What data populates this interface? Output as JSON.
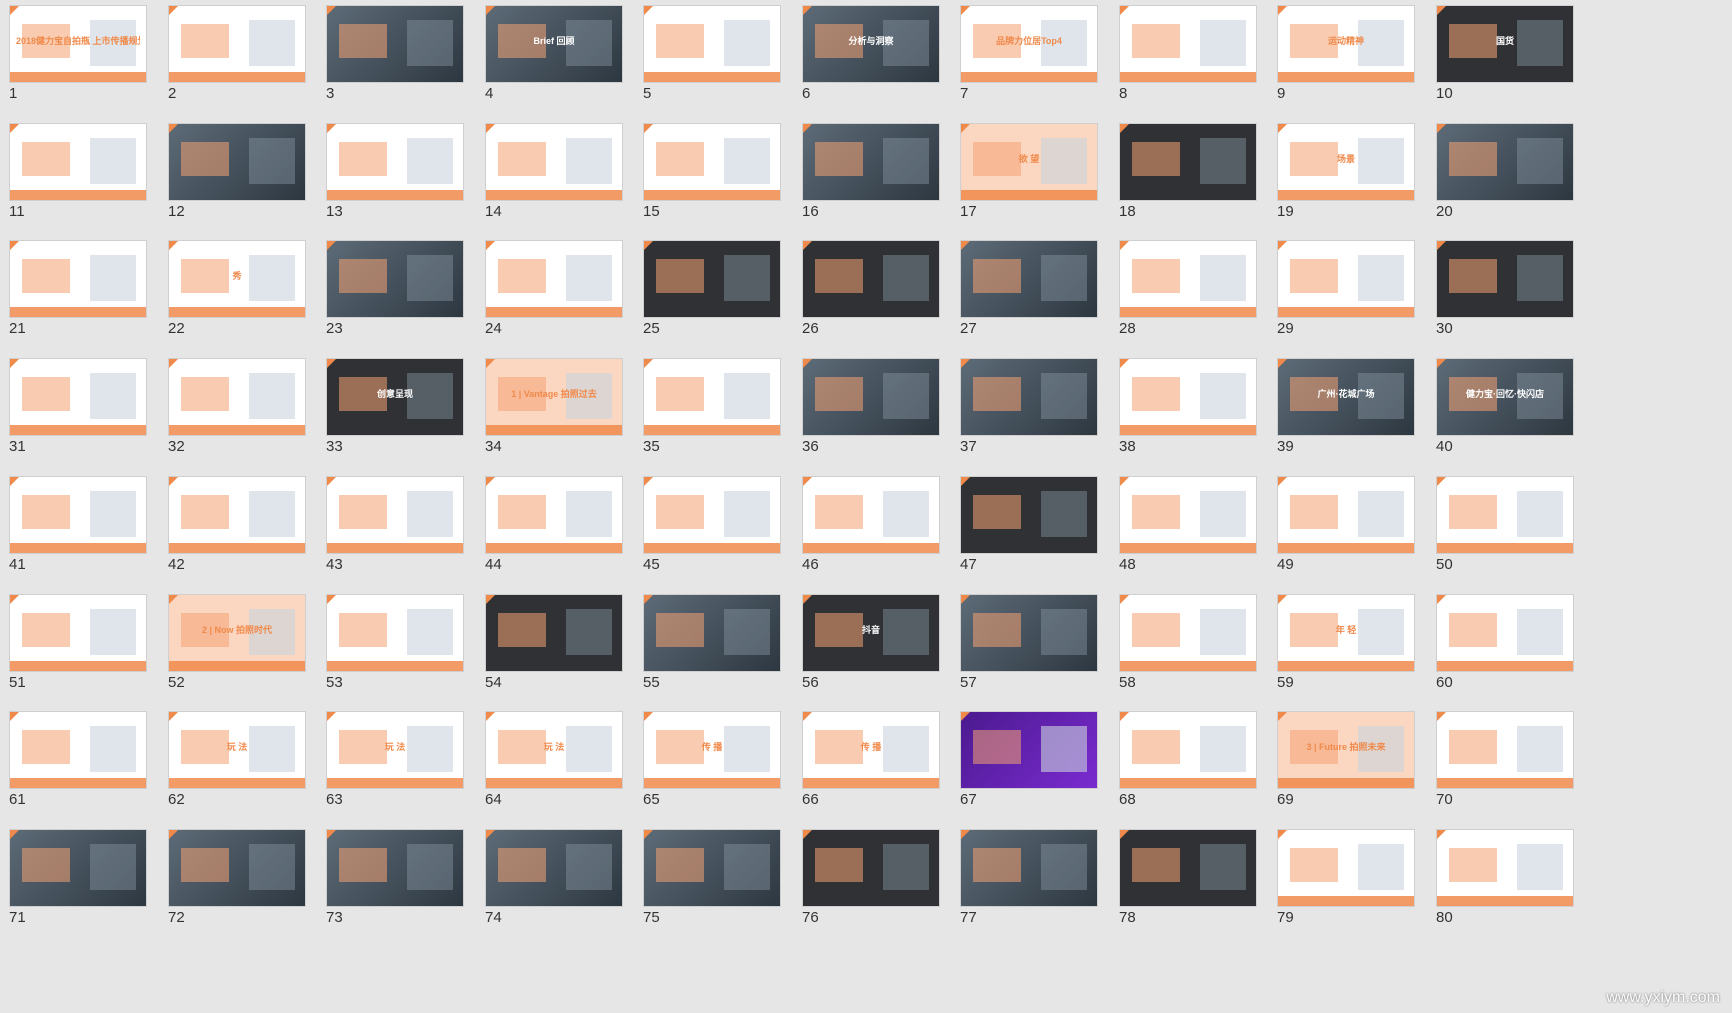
{
  "slides": [
    {
      "number": "1",
      "caption": "2018健力宝自拍瓶 上市传播规划",
      "style": "white"
    },
    {
      "number": "2",
      "caption": "",
      "style": "white"
    },
    {
      "number": "3",
      "caption": "",
      "style": "photo"
    },
    {
      "number": "4",
      "caption": "Brief 回顾",
      "style": "photo"
    },
    {
      "number": "5",
      "caption": "",
      "style": "white"
    },
    {
      "number": "6",
      "caption": "分析与洞察",
      "style": "photo"
    },
    {
      "number": "7",
      "caption": "品牌力位居Top4",
      "style": "white"
    },
    {
      "number": "8",
      "caption": "",
      "style": "white"
    },
    {
      "number": "9",
      "caption": "运动精神",
      "style": "white"
    },
    {
      "number": "10",
      "caption": "国货",
      "style": "dark"
    },
    {
      "number": "11",
      "caption": "",
      "style": "white"
    },
    {
      "number": "12",
      "caption": "",
      "style": "photo"
    },
    {
      "number": "13",
      "caption": "",
      "style": "white"
    },
    {
      "number": "14",
      "caption": "",
      "style": "white"
    },
    {
      "number": "15",
      "caption": "",
      "style": "white"
    },
    {
      "number": "16",
      "caption": "",
      "style": "photo"
    },
    {
      "number": "17",
      "caption": "欲 望",
      "style": "peach"
    },
    {
      "number": "18",
      "caption": "",
      "style": "dark"
    },
    {
      "number": "19",
      "caption": "场景",
      "style": "white"
    },
    {
      "number": "20",
      "caption": "",
      "style": "photo"
    },
    {
      "number": "21",
      "caption": "",
      "style": "white"
    },
    {
      "number": "22",
      "caption": "秀",
      "style": "white"
    },
    {
      "number": "23",
      "caption": "",
      "style": "photo"
    },
    {
      "number": "24",
      "caption": "",
      "style": "white"
    },
    {
      "number": "25",
      "caption": "",
      "style": "dark"
    },
    {
      "number": "26",
      "caption": "",
      "style": "dark"
    },
    {
      "number": "27",
      "caption": "",
      "style": "photo"
    },
    {
      "number": "28",
      "caption": "",
      "style": "white"
    },
    {
      "number": "29",
      "caption": "",
      "style": "white"
    },
    {
      "number": "30",
      "caption": "",
      "style": "dark"
    },
    {
      "number": "31",
      "caption": "",
      "style": "white"
    },
    {
      "number": "32",
      "caption": "",
      "style": "white"
    },
    {
      "number": "33",
      "caption": "创意呈现",
      "style": "dark"
    },
    {
      "number": "34",
      "caption": "1 | Vantage 拍照过去",
      "style": "peach"
    },
    {
      "number": "35",
      "caption": "",
      "style": "white"
    },
    {
      "number": "36",
      "caption": "",
      "style": "photo"
    },
    {
      "number": "37",
      "caption": "",
      "style": "photo"
    },
    {
      "number": "38",
      "caption": "",
      "style": "white"
    },
    {
      "number": "39",
      "caption": "广州·花城广场",
      "style": "photo"
    },
    {
      "number": "40",
      "caption": "健力宝·回忆·快闪店",
      "style": "photo"
    },
    {
      "number": "41",
      "caption": "",
      "style": "white"
    },
    {
      "number": "42",
      "caption": "",
      "style": "white"
    },
    {
      "number": "43",
      "caption": "",
      "style": "white"
    },
    {
      "number": "44",
      "caption": "",
      "style": "white"
    },
    {
      "number": "45",
      "caption": "",
      "style": "white"
    },
    {
      "number": "46",
      "caption": "",
      "style": "white"
    },
    {
      "number": "47",
      "caption": "",
      "style": "dark"
    },
    {
      "number": "48",
      "caption": "",
      "style": "white"
    },
    {
      "number": "49",
      "caption": "",
      "style": "white"
    },
    {
      "number": "50",
      "caption": "",
      "style": "white"
    },
    {
      "number": "51",
      "caption": "",
      "style": "white"
    },
    {
      "number": "52",
      "caption": "2 | Now 拍照时代",
      "style": "peach"
    },
    {
      "number": "53",
      "caption": "",
      "style": "white"
    },
    {
      "number": "54",
      "caption": "",
      "style": "dark"
    },
    {
      "number": "55",
      "caption": "",
      "style": "photo"
    },
    {
      "number": "56",
      "caption": "抖音",
      "style": "dark"
    },
    {
      "number": "57",
      "caption": "",
      "style": "photo"
    },
    {
      "number": "58",
      "caption": "",
      "style": "white"
    },
    {
      "number": "59",
      "caption": "年 轻",
      "style": "white"
    },
    {
      "number": "60",
      "caption": "",
      "style": "white"
    },
    {
      "number": "61",
      "caption": "",
      "style": "white"
    },
    {
      "number": "62",
      "caption": "玩 法",
      "style": "white"
    },
    {
      "number": "63",
      "caption": "玩 法",
      "style": "white"
    },
    {
      "number": "64",
      "caption": "玩 法",
      "style": "white"
    },
    {
      "number": "65",
      "caption": "传 播",
      "style": "white"
    },
    {
      "number": "66",
      "caption": "传 播",
      "style": "white"
    },
    {
      "number": "67",
      "caption": "",
      "style": "purple"
    },
    {
      "number": "68",
      "caption": "",
      "style": "white"
    },
    {
      "number": "69",
      "caption": "3 | Future 拍照未来",
      "style": "peach"
    },
    {
      "number": "70",
      "caption": "",
      "style": "white"
    },
    {
      "number": "71",
      "caption": "",
      "style": "photo"
    },
    {
      "number": "72",
      "caption": "",
      "style": "photo"
    },
    {
      "number": "73",
      "caption": "",
      "style": "photo"
    },
    {
      "number": "74",
      "caption": "",
      "style": "photo"
    },
    {
      "number": "75",
      "caption": "",
      "style": "photo"
    },
    {
      "number": "76",
      "caption": "",
      "style": "dark"
    },
    {
      "number": "77",
      "caption": "",
      "style": "photo"
    },
    {
      "number": "78",
      "caption": "",
      "style": "dark"
    },
    {
      "number": "79",
      "caption": "",
      "style": "white"
    },
    {
      "number": "80",
      "caption": "",
      "style": "white"
    }
  ],
  "watermark": "www.yxiym.com",
  "colors": {
    "background": "#e6e6e6",
    "accent": "#f08a4b",
    "slide_border": "#cfcfcf",
    "number_text": "#333333"
  }
}
